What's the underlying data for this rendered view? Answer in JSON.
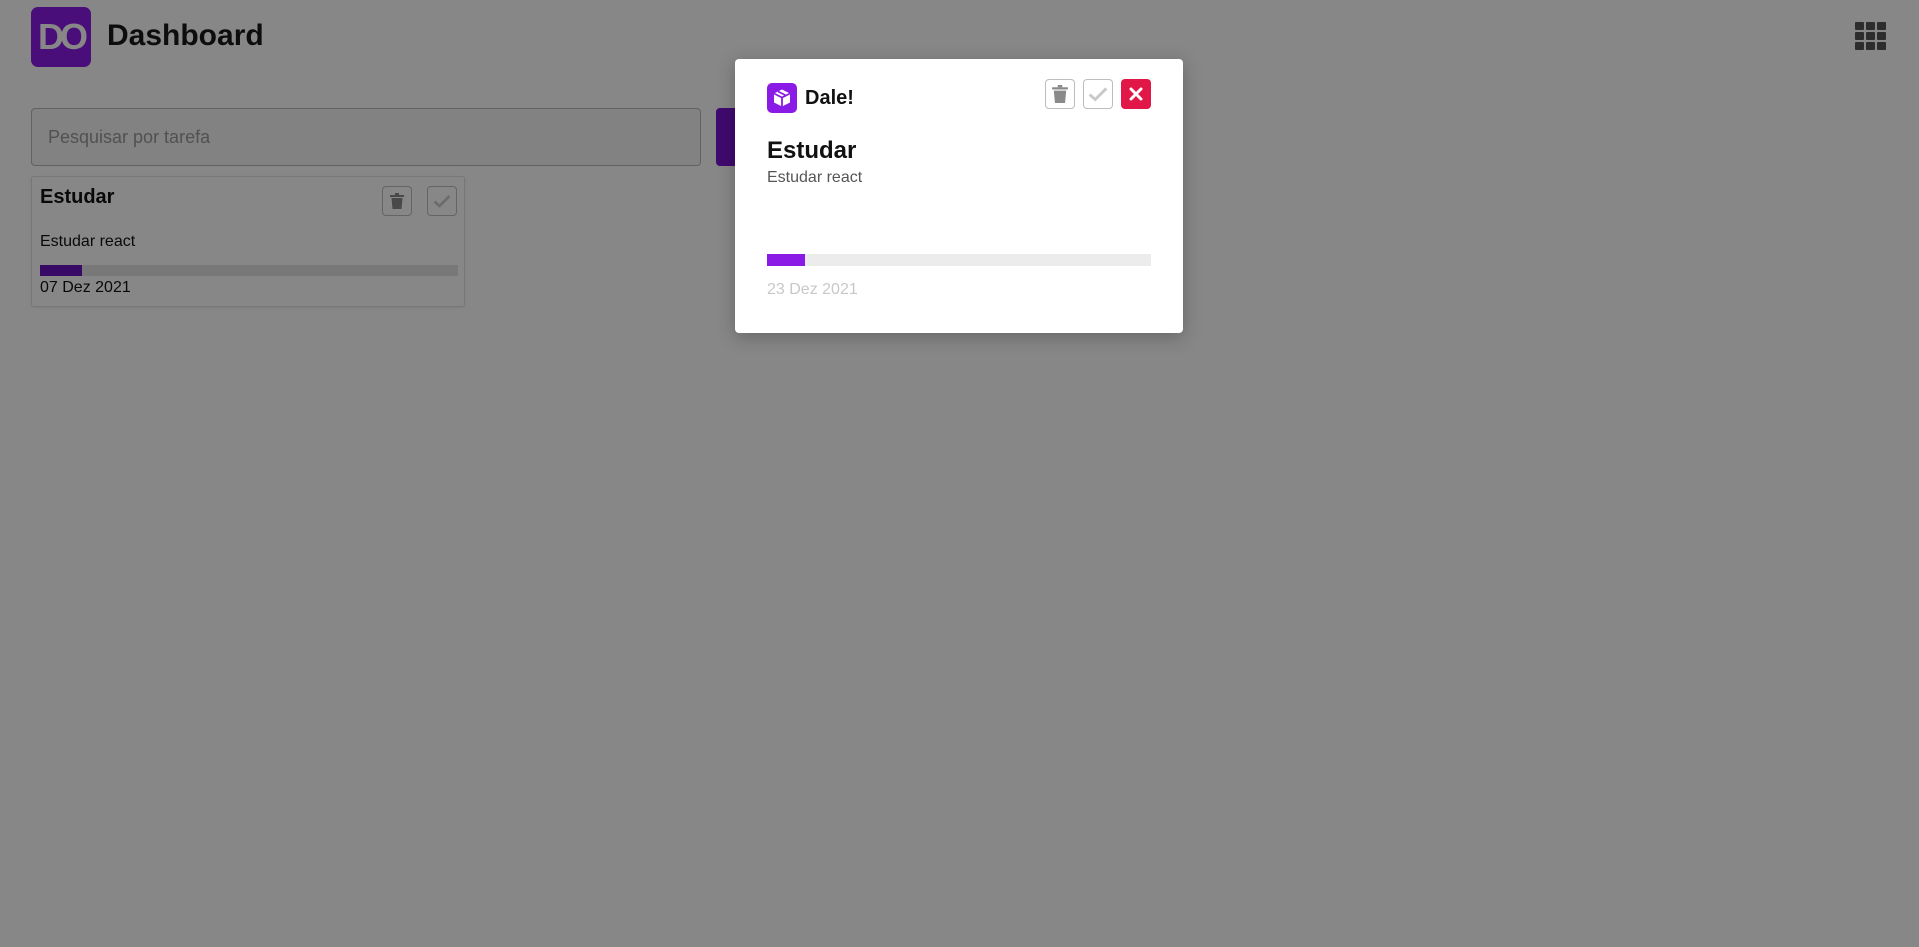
{
  "header": {
    "logo_text": "DO",
    "title": "Dashboard",
    "menu_icon": "grid-icon"
  },
  "search": {
    "placeholder": "Pesquisar por tarefa",
    "value": ""
  },
  "tasks": [
    {
      "title": "Estudar",
      "description": "Estudar react",
      "progress": 0.1,
      "date": "07 Dez 2021"
    }
  ],
  "modal": {
    "brand": "Dale!",
    "brand_icon": "box-icon",
    "title": "Estudar",
    "description": "Estudar react",
    "progress": 0.1,
    "date": "23 Dez 2021",
    "actions": [
      "trash-icon",
      "check-icon",
      "close-icon"
    ]
  },
  "colors": {
    "accent": "#8a1be6",
    "accent_dark": "#6d12c0",
    "danger": "#e01747",
    "overlay": "rgba(0,0,0,0.47)"
  }
}
